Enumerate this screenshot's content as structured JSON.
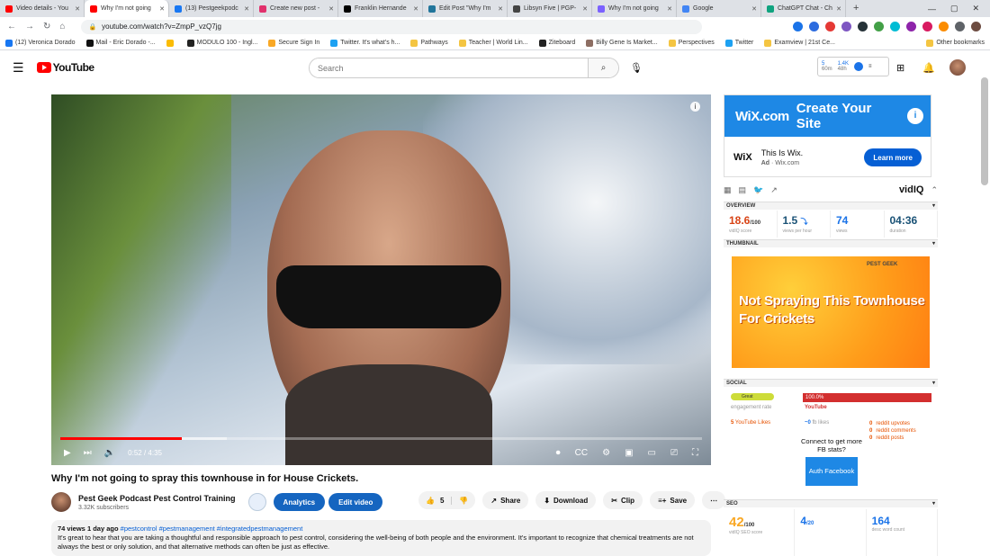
{
  "browser": {
    "tabs": [
      {
        "title": "Video details - You",
        "color": "#ff0000"
      },
      {
        "title": "Why I'm not going",
        "color": "#ff0000",
        "active": true
      },
      {
        "title": "(13) Pestgeekpodc",
        "color": "#1877f2"
      },
      {
        "title": "Create new post -",
        "color": "#e1306c"
      },
      {
        "title": "Franklin Hernande",
        "color": "#000000"
      },
      {
        "title": "Edit Post \"Why I'm",
        "color": "#21759b"
      },
      {
        "title": "Libsyn Five | PGP-",
        "color": "#444444"
      },
      {
        "title": "Why I'm not going",
        "color": "#7b61ff"
      },
      {
        "title": "Google",
        "color": "#4285f4"
      },
      {
        "title": "ChatGPT Chat - Ch",
        "color": "#10a37f"
      }
    ],
    "url": "youtube.com/watch?v=ZmpP_vzQ7jg",
    "bookmarks": [
      "(12) Veronica Dorado",
      "Mail - Eric Dorado -...",
      "",
      "MODULO 100 - Ingl...",
      "Secure Sign In",
      "Twitter. It's what's h...",
      "Pathways",
      "Teacher | World Lin...",
      "Ziteboard",
      "Billy Gene Is Market...",
      "Perspectives",
      "Twitter",
      "Examview | 21st Ce...",
      "Other bookmarks"
    ]
  },
  "youtube": {
    "logo_text": "YouTube",
    "search_placeholder": "Search",
    "vidiq_badge": {
      "a": "5",
      "b": "1.4K",
      "a_sub": "60m",
      "b_sub": "48h"
    }
  },
  "player": {
    "time": "0:52 / 4:35",
    "progress": 0.189,
    "buffered": 0.26
  },
  "video": {
    "title": "Why I'm not going to spray this townhouse in for House Crickets.",
    "channel": "Pest Geek Podcast Pest Control Training",
    "subscribers": "3.32K subscribers",
    "analytics_label": "Analytics",
    "edit_label": "Edit video",
    "likes": "5",
    "share_label": "Share",
    "download_label": "Download",
    "clip_label": "Clip",
    "save_label": "Save",
    "views": "74 views",
    "age": "1 day ago",
    "hashtags": "#pestcontrol #pestmanagement #integratedpestmanagement",
    "description": "It's great to hear that you are taking a thoughtful and responsible approach to pest control, considering the well-being of both people and the environment. It's important to recognize that chemical treatments are not always the best or only solution, and that alternative methods can often be just as effective."
  },
  "ad": {
    "banner_brand": "WiX.com",
    "banner_text": "Create Your Site",
    "logo": "WiX",
    "headline": "This Is Wix.",
    "sponsor_tag": "Ad",
    "domain": "Wix.com",
    "cta": "Learn more"
  },
  "vidiq": {
    "brand": "vidIQ",
    "overview_label": "OVERVIEW",
    "score": "18.6",
    "score_max": "/100",
    "score_lbl": "vidIQ score",
    "vph": "1.5",
    "vph_lbl": "views per hour",
    "views": "74",
    "views_lbl": "views",
    "duration": "04:36",
    "duration_lbl": "duration",
    "thumbnail_label": "THUMBNAIL",
    "thumb_text": "Not Spraying This Townhouse For Crickets",
    "thumb_logo": "PEST GEEK",
    "social_label": "SOCIAL",
    "engagement_pill": "Great",
    "engagement_lbl": "engagement rate",
    "youtube_pct": "100.0%",
    "youtube_lbl": "YouTube",
    "yt_likes_n": "5",
    "yt_likes_lbl": "YouTube Likes",
    "fb_likes_n": "~0",
    "fb_likes_lbl": "fb likes",
    "reddit": [
      {
        "n": "0",
        "lbl": "reddit upvotes"
      },
      {
        "n": "0",
        "lbl": "reddit comments"
      },
      {
        "n": "0",
        "lbl": "reddit posts"
      }
    ],
    "fb_prompt": "Connect to get more FB stats?",
    "fb_prompt_bold": "FB",
    "fb_button": "Auth Facebook",
    "seo_label": "SEO",
    "seo_score": "42",
    "seo_max": "/100",
    "seo_lbl": "vidIQ SEO score",
    "tags_n": "4",
    "tags_max": "/20",
    "word_count": "164",
    "word_count_lbl": "desc word count"
  },
  "colors": {
    "yt_red": "#ff0000",
    "blue_btn": "#1565c0",
    "vidiq_blue": "#1a73e8"
  }
}
